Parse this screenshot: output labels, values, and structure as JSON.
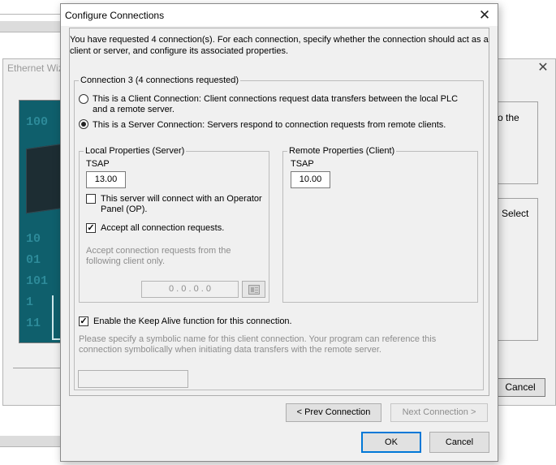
{
  "wizard": {
    "title": "Ethernet Wiz",
    "close_glyph": "✕",
    "partial_text_1": "o the",
    "partial_text_2": "Select",
    "cancel_label": "Cancel",
    "bits": [
      "100",
      "10",
      "01",
      "101",
      "1",
      "11"
    ]
  },
  "dialog": {
    "title": "Configure Connections",
    "close_glyph": "✕",
    "intro": "You have requested 4 connection(s).  For each connection, specify whether the connection should act as a client or server, and configure its associated properties.",
    "connection_group_legend": "Connection 3 (4 connections requested)",
    "radio_client": {
      "label": "This is a Client Connection: Client connections request data transfers between the local PLC and a remote server.",
      "selected": false
    },
    "radio_server": {
      "label": "This is a Server Connection: Servers respond to connection requests from remote clients.",
      "selected": true
    },
    "local": {
      "legend": "Local Properties (Server)",
      "tsap_label": "TSAP",
      "tsap_value": "13.00",
      "operator_panel_label": "This server will connect with an Operator Panel (OP).",
      "operator_panel_checked": false,
      "accept_all_label": "Accept all connection requests.",
      "accept_all_checked": true,
      "accept_from_label": "Accept connection requests from the following client only.",
      "ip_value": "0 . 0 . 0 . 0",
      "ip_button_icon": "address-book-icon"
    },
    "remote": {
      "legend": "Remote Properties (Client)",
      "tsap_label": "TSAP",
      "tsap_value": "10.00"
    },
    "keep_alive_label": "Enable the Keep Alive function for this connection.",
    "keep_alive_checked": true,
    "symbolic_hint": "Please specify a symbolic name for this client connection.  Your program can reference this connection symbolically when initiating data transfers with the remote server.",
    "symbolic_name_value": "",
    "prev_connection_label": "< Prev Connection",
    "next_connection_label": "Next Connection >",
    "ok_label": "OK",
    "cancel_label": "Cancel",
    "check_glyph": "✓"
  }
}
